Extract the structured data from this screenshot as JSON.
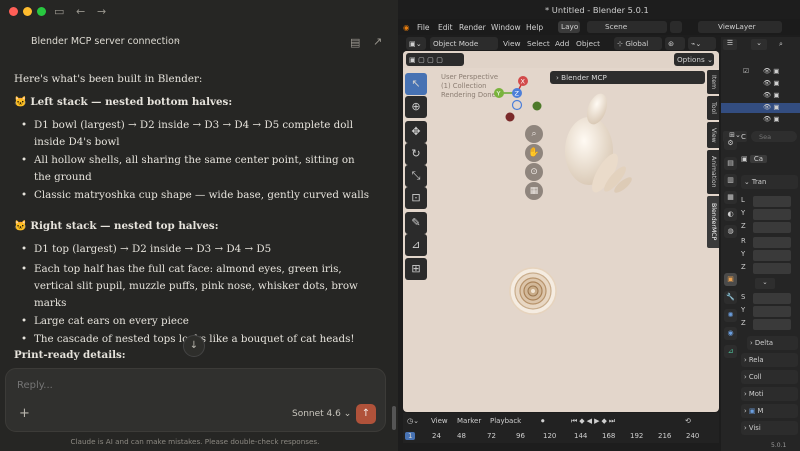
{
  "claude": {
    "conversation_title": "Blender MCP server connection",
    "intro": "Here's what's been built in Blender:",
    "sections": [
      {
        "heading": "🐱 Left stack — nested bottom halves:",
        "bullets": [
          "D1 bowl (largest) → D2 inside → D3 → D4 → D5 complete doll inside D4's bowl",
          "All hollow shells, all sharing the same center point, sitting on the ground",
          "Classic matryoshka cup shape — wide base, gently curved walls"
        ]
      },
      {
        "heading": "🐱 Right stack — nested top halves:",
        "bullets": [
          "D1 top (largest) → D2 inside → D3 → D4 → D5",
          "Each top half has the full cat face: almond eyes, green iris, vertical slit pupil, muzzle puffs, pink nose, whisker dots, brow marks",
          "Large cat ears on every piece",
          "The cascade of nested tops looks like a bouquet of cat heads!"
        ]
      }
    ],
    "print_heading": "Print-ready details:",
    "composer_placeholder": "Reply...",
    "model": "Sonnet 4.6",
    "disclaimer": "Claude is AI and can make mistakes. Please double-check responses."
  },
  "blender": {
    "window_title": "* Untitled - Blender 5.0.1",
    "menu": [
      "File",
      "Edit",
      "Render",
      "Window",
      "Help"
    ],
    "workspace": "Layo",
    "scene": "Scene",
    "view_layer": "ViewLayer",
    "mode": "Object Mode",
    "header_menu": [
      "View",
      "Select",
      "Add",
      "Object"
    ],
    "orientation": "Global",
    "options": "Options",
    "viewport_overlay": [
      "User Perspective",
      "(1) Collection",
      "Rendering Done"
    ],
    "gizmo": [
      "X",
      "Y",
      "Z"
    ],
    "n_panel_header": "Blender MCP",
    "side_tabs": [
      "Item",
      "Tool",
      "View",
      "Animation",
      "BlenderMCP"
    ],
    "timeline_menu": [
      "View",
      "Marker",
      "Playback"
    ],
    "frames": [
      "1",
      "24",
      "48",
      "72",
      "96",
      "120",
      "144",
      "168",
      "192",
      "216",
      "240"
    ],
    "properties": {
      "search_placeholder": "Sea",
      "object_name": "C",
      "object_data": "Ca",
      "sections": [
        "Tran",
        "Delta",
        "Rela",
        "Coll",
        "Moti",
        "M",
        "Visi"
      ],
      "location_labels": [
        "L",
        "Y",
        "Z"
      ],
      "rotation_labels": [
        "R",
        "Y",
        "Z"
      ],
      "scale_labels": [
        "S",
        "Y",
        "Z"
      ],
      "version": "5.0.1"
    }
  }
}
